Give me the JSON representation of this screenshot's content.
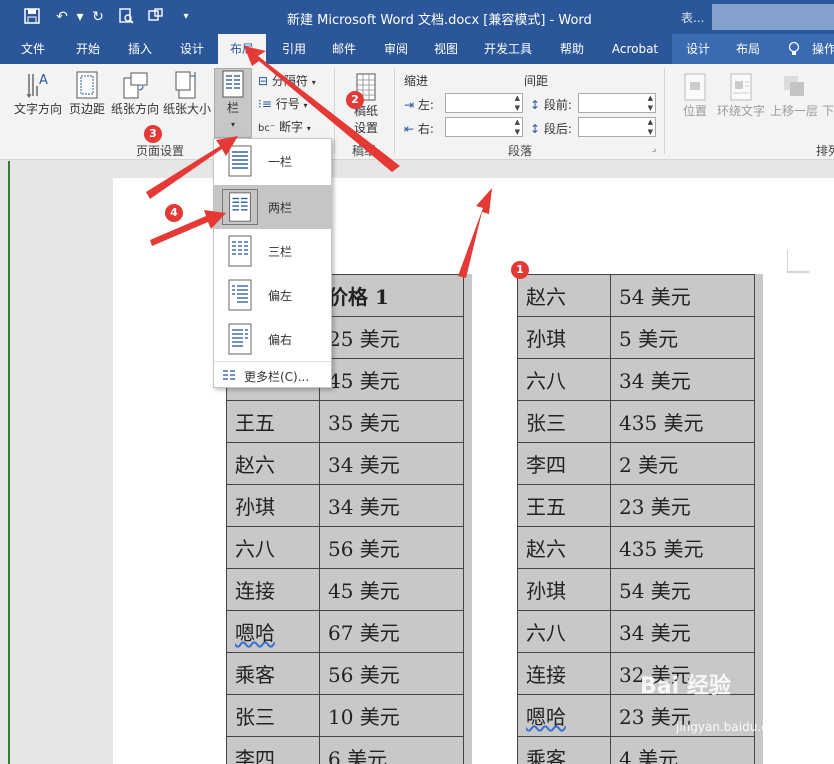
{
  "titlebar": {
    "doc_title": "新建 Microsoft Word 文档.docx [兼容模式] - Word",
    "extra": "表..."
  },
  "tabs": [
    "文件",
    "开始",
    "插入",
    "设计",
    "布局",
    "引用",
    "邮件",
    "审阅",
    "视图",
    "开发工具",
    "帮助",
    "Acrobat",
    "设计",
    "布局",
    "操作"
  ],
  "ribbon": {
    "page_setup": {
      "text_direction": "文字方向",
      "margins": "页边距",
      "orientation": "纸张方向",
      "size": "纸张大小",
      "columns": "栏",
      "breaks": "分隔符",
      "line_numbers": "行号",
      "hyphenation": "断字",
      "group": "页面设置"
    },
    "draft": {
      "label1": "稿纸",
      "label2": "设置",
      "group": "稿纸"
    },
    "paragraph": {
      "indent": "缩进",
      "spacing": "间距",
      "left": "左:",
      "right": "右:",
      "before": "段前:",
      "after": "段后:",
      "group": "段落"
    },
    "arrange": {
      "position": "位置",
      "wrap": "环绕文字",
      "forward": "上移一层",
      "down": "下",
      "group": "排列"
    }
  },
  "columns_menu": {
    "items": [
      "一栏",
      "两栏",
      "三栏",
      "偏左",
      "偏右"
    ],
    "selected": "两栏",
    "more": "更多栏(C)..."
  },
  "table_left": {
    "header_partial": "价格 1",
    "rows": [
      [
        "",
        "25 美元"
      ],
      [
        "",
        "45 美元"
      ],
      [
        "王五",
        "35 美元"
      ],
      [
        "赵六",
        "34 美元"
      ],
      [
        "孙琪",
        "34 美元"
      ],
      [
        "六八",
        "56 美元"
      ],
      [
        "连接",
        "45 美元"
      ],
      [
        "嗯哈",
        "67 美元"
      ],
      [
        "乘客",
        "56 美元"
      ],
      [
        "张三",
        "10 美元"
      ],
      [
        "李四",
        "6 美元"
      ]
    ]
  },
  "table_right": {
    "rows": [
      [
        "赵六",
        "54 美元"
      ],
      [
        "孙琪",
        "5 美元"
      ],
      [
        "六八",
        "34 美元"
      ],
      [
        "张三",
        "435 美元"
      ],
      [
        "李四",
        "2 美元"
      ],
      [
        "王五",
        "23 美元"
      ],
      [
        "赵六",
        "435 美元"
      ],
      [
        "孙琪",
        "54 美元"
      ],
      [
        "六八",
        "34 美元"
      ],
      [
        "连接",
        "32 美元"
      ],
      [
        "嗯哈",
        "23 美元"
      ],
      [
        "乘客",
        "4 美元"
      ]
    ]
  },
  "annotations": [
    "1",
    "2",
    "3",
    "4"
  ],
  "watermark": {
    "brand": "Bai 经验",
    "url": "jingyan.baidu.com"
  },
  "colors": {
    "word_blue": "#2b579a",
    "annotation_red": "#e53935",
    "cell_gray": "#c8c8c8"
  }
}
